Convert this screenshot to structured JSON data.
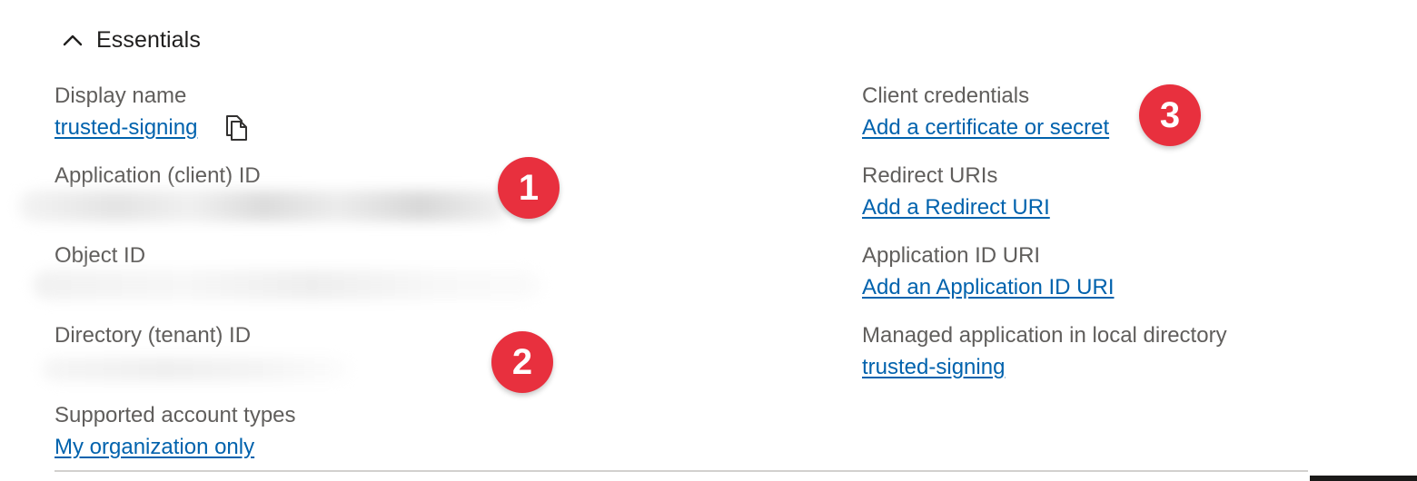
{
  "section": {
    "title": "Essentials",
    "chevron_icon": "chevron-up-icon"
  },
  "left": {
    "display_name": {
      "label": "Display name",
      "value": "trusted-signing",
      "copy_icon": "copy-icon"
    },
    "application_id": {
      "label": "Application (client) ID",
      "value_redacted": true
    },
    "object_id": {
      "label": "Object ID",
      "value_redacted": true
    },
    "directory_id": {
      "label": "Directory (tenant) ID",
      "value_redacted": true
    },
    "supported_account_types": {
      "label": "Supported account types",
      "value": "My organization only"
    }
  },
  "right": {
    "client_credentials": {
      "label": "Client credentials",
      "value": "Add a certificate or secret"
    },
    "redirect_uris": {
      "label": "Redirect URIs",
      "value": "Add a Redirect URI"
    },
    "application_id_uri": {
      "label": "Application ID URI",
      "value": "Add an Application ID URI"
    },
    "managed_application": {
      "label": "Managed application in local directory",
      "value": "trusted-signing"
    }
  },
  "annotations": {
    "badge_1": "1",
    "badge_2": "2",
    "badge_3": "3",
    "color": "#e8303e"
  },
  "colors": {
    "link": "#0062ad",
    "label": "#605e5c",
    "heading": "#201f1e"
  }
}
